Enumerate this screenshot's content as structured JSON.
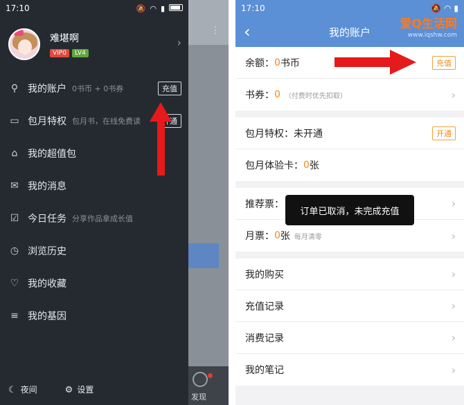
{
  "left": {
    "status": {
      "time": "17:10"
    },
    "background_app": {
      "discover_label": "发现"
    },
    "profile": {
      "name": "难堪啊",
      "vip": "VIP0",
      "level": "LV4"
    },
    "menu": [
      {
        "icon": "user-icon",
        "label": "我的账户",
        "sub": "0书币 + 0书券",
        "tag": "充值"
      },
      {
        "icon": "book-icon",
        "label": "包月特权",
        "sub": "包月书，在线免费读",
        "tag": "开通"
      },
      {
        "icon": "gift-icon",
        "label": "我的超值包",
        "sub": "",
        "tag": ""
      },
      {
        "icon": "mail-icon",
        "label": "我的消息",
        "sub": "",
        "tag": ""
      },
      {
        "icon": "checkbox-icon",
        "label": "今日任务",
        "sub": "分享作品拿成长值",
        "tag": ""
      },
      {
        "icon": "clock-icon",
        "label": "浏览历史",
        "sub": "",
        "tag": ""
      },
      {
        "icon": "heart-icon",
        "label": "我的收藏",
        "sub": "",
        "tag": ""
      },
      {
        "icon": "dna-icon",
        "label": "我的基因",
        "sub": "",
        "tag": ""
      }
    ],
    "bottom": {
      "night": "夜间",
      "settings": "设置"
    }
  },
  "right": {
    "status": {
      "time": "17:10"
    },
    "header": {
      "title": "我的账户"
    },
    "watermark": {
      "text": "爱Q生活网",
      "url": "www.iqshw.com"
    },
    "balance": {
      "label": "余额：",
      "value": "0",
      "unit": "书币",
      "button": "充值"
    },
    "voucher": {
      "label": "书券：",
      "value": "0",
      "note": "（付费时优先扣取）"
    },
    "monthly": {
      "label": "包月特权：未开通",
      "button": "开通"
    },
    "trial": {
      "label": "包月体验卡：",
      "value": "0",
      "unit": "张"
    },
    "recommend": {
      "label": "推荐票："
    },
    "monthly_ticket": {
      "label": "月票：",
      "value": "0",
      "unit": "张",
      "note": "每月清零"
    },
    "toast": "订单已取消，未完成充值",
    "links": [
      "我的购买",
      "充值记录",
      "消费记录",
      "我的笔记"
    ]
  }
}
